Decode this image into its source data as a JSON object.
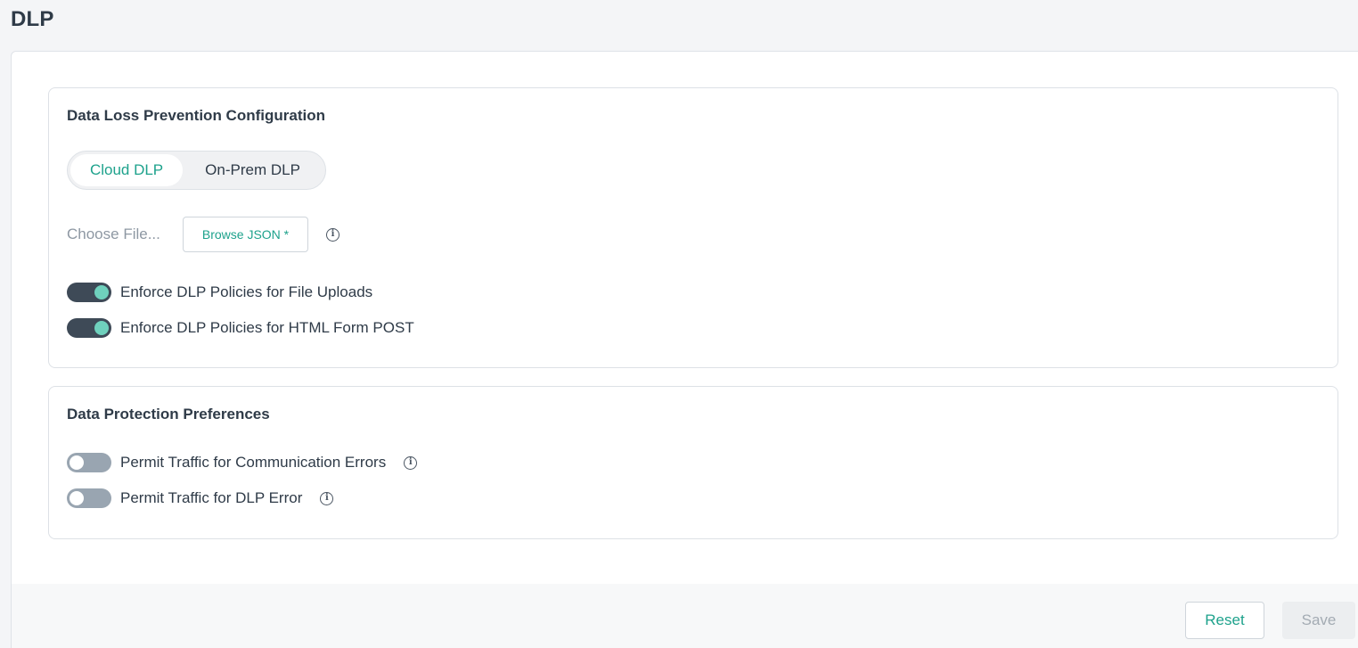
{
  "page": {
    "title": "DLP"
  },
  "dlp_config": {
    "title": "Data Loss Prevention Configuration",
    "tabs": [
      {
        "label": "Cloud DLP",
        "active": true
      },
      {
        "label": "On-Prem DLP",
        "active": false
      }
    ],
    "file": {
      "placeholder": "Choose File...",
      "browse_label": "Browse JSON *"
    },
    "toggles": [
      {
        "label": "Enforce DLP Policies for File Uploads",
        "on": true
      },
      {
        "label": "Enforce DLP Policies for HTML Form POST",
        "on": true
      }
    ]
  },
  "preferences": {
    "title": "Data Protection Preferences",
    "toggles": [
      {
        "label": "Permit Traffic for Communication Errors",
        "on": false
      },
      {
        "label": "Permit Traffic for DLP Error",
        "on": false
      }
    ]
  },
  "footer": {
    "reset_label": "Reset",
    "save_label": "Save"
  },
  "colors": {
    "accent": "#1ea28c",
    "toggle_on_track": "#3e4a57",
    "toggle_on_knob": "#6fd1bd",
    "toggle_off_track": "#99a5b1"
  },
  "icons": {
    "info": "info-circle-icon"
  }
}
